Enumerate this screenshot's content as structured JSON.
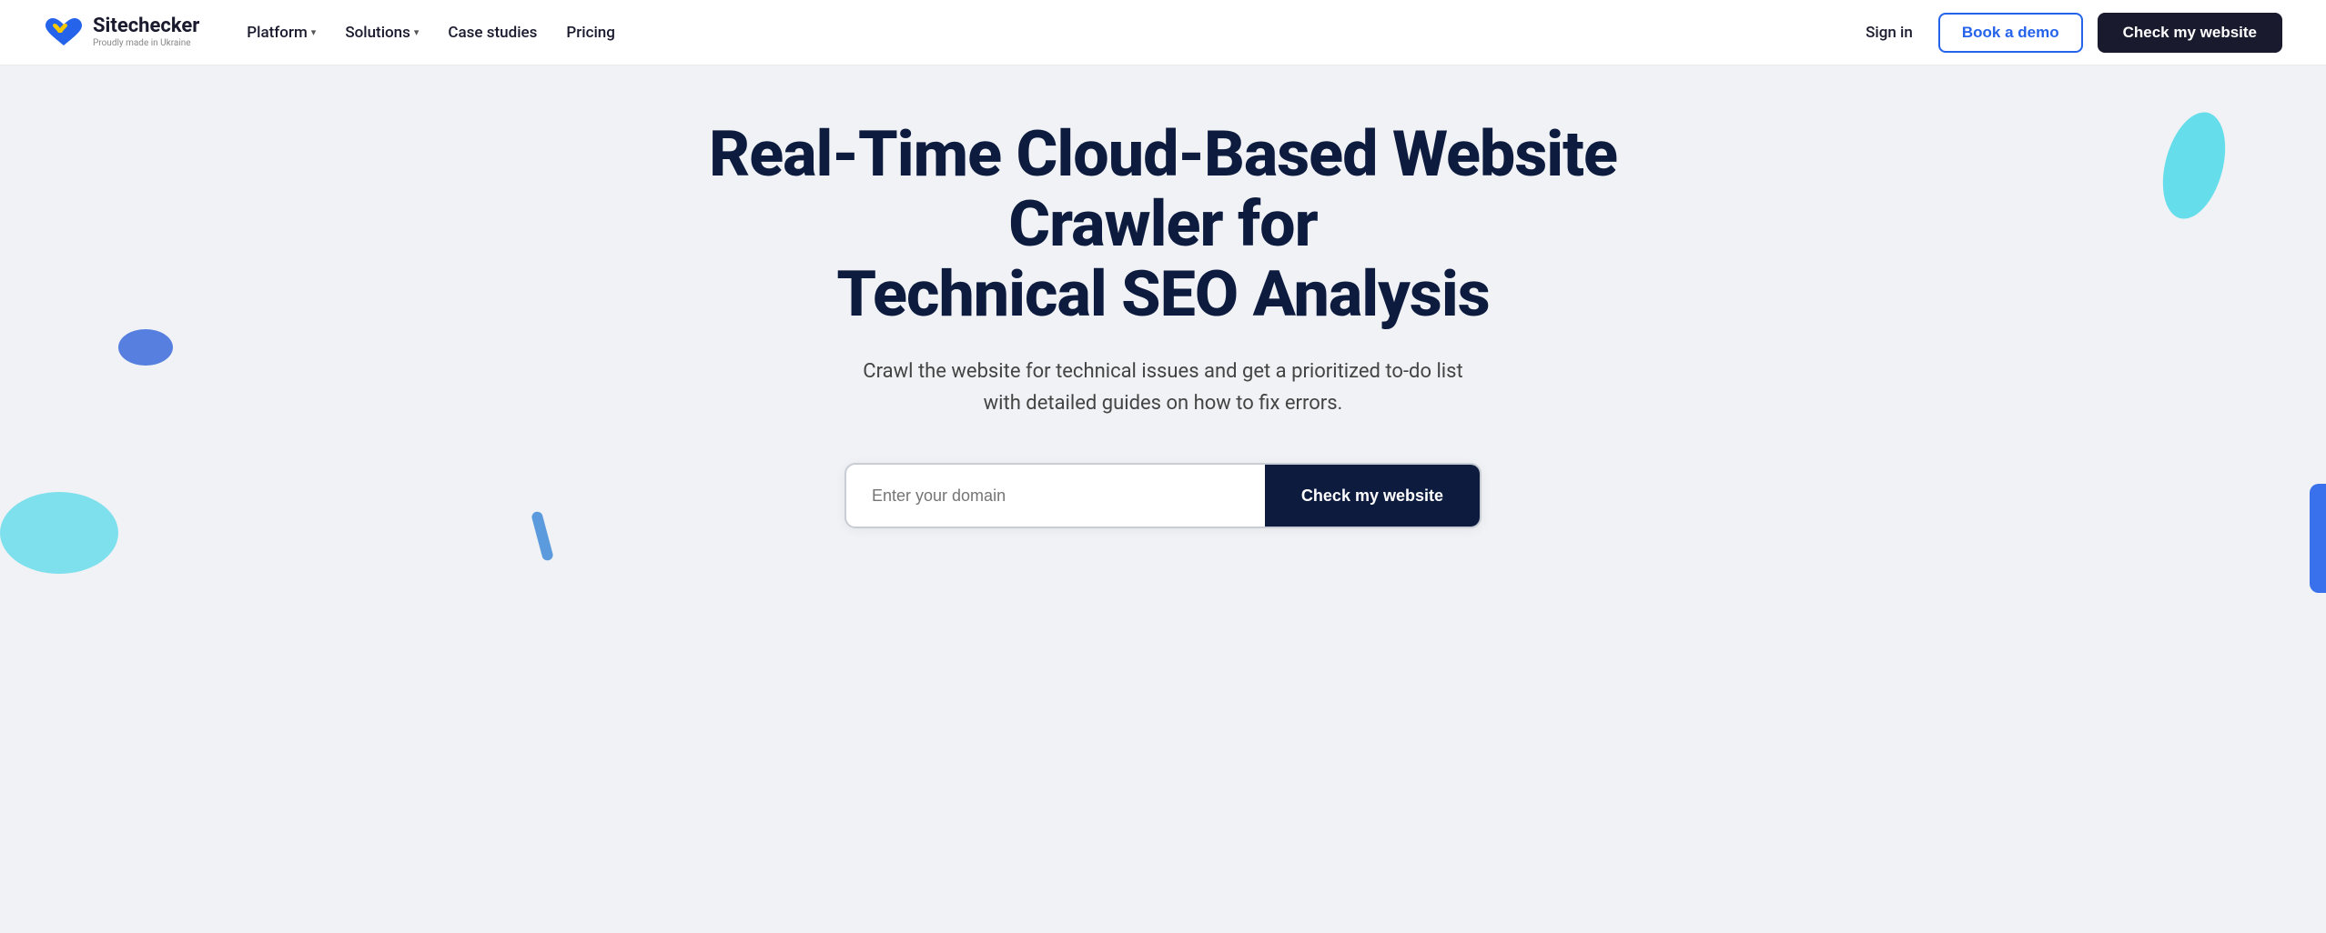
{
  "logo": {
    "name": "Sitechecker",
    "tagline": "Proudly made in Ukraine"
  },
  "nav": {
    "items": [
      {
        "label": "Platform",
        "has_dropdown": true
      },
      {
        "label": "Solutions",
        "has_dropdown": true
      },
      {
        "label": "Case studies",
        "has_dropdown": false
      },
      {
        "label": "Pricing",
        "has_dropdown": false
      }
    ],
    "sign_in": "Sign in",
    "book_demo": "Book a demo",
    "check_website_nav": "Check my website"
  },
  "hero": {
    "title_line1": "Real-Time Cloud-Based Website Crawler for",
    "title_line2": "Technical SEO Analysis",
    "subtitle": "Crawl the website for technical issues and get a prioritized to-do list with detailed guides on how to fix errors.",
    "input_placeholder": "Enter your domain",
    "cta_button": "Check my website"
  }
}
